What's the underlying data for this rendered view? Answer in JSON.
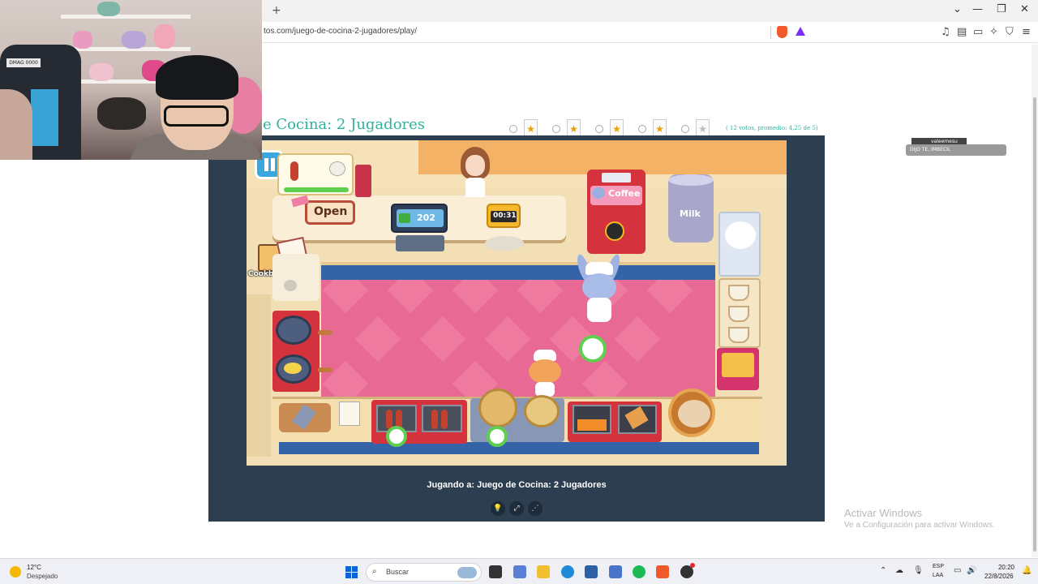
{
  "browser": {
    "url": "tos.com/juego-de-cocina-2-jugadores/play/",
    "new_tab_symbol": "+",
    "controls": {
      "menu": "⌄",
      "minimize": "—",
      "restore": "❐",
      "close": "✕"
    }
  },
  "webcam": {
    "chair_badge": "DMAG 0000"
  },
  "page": {
    "title": "e Cocina: 2 Jugadores",
    "rating": {
      "stars": [
        {
          "symbol": "★",
          "filled": true
        },
        {
          "symbol": "★",
          "filled": true
        },
        {
          "symbol": "★",
          "filled": true
        },
        {
          "symbol": "★",
          "filled": true
        },
        {
          "symbol": "★",
          "filled": false
        }
      ],
      "votes_text": "( 12 votos, promedio: 4,25 de 5)"
    },
    "chat": {
      "username": "valeemesu",
      "message": "DIJO TE, IMBECIL"
    }
  },
  "game": {
    "playing_label": "Jugando a: Juego de Cocina: 2 Jugadores",
    "hud": {
      "open_sign": "Open",
      "money": "202",
      "timer": "00:31",
      "coffee_label": "Coffee",
      "milk_label": "Milk",
      "cookbook_label": "Cookbook"
    },
    "controls": {
      "lightbulb_symbol": "💡",
      "fullscreen_symbol": "⤢",
      "share_symbol": "⋰"
    }
  },
  "watermark": {
    "line1": "Activar Windows",
    "line2": "Ve a Configuración para activar Windows."
  },
  "taskbar": {
    "temperature": "12°C",
    "condition": "Despejado",
    "search_placeholder": "Buscar",
    "lang_line1": "ESP",
    "lang_line2": "LAA",
    "time": "20:20",
    "date": "22/8/2026"
  },
  "colors": {
    "title_teal": "#2fb39a",
    "frame_navy": "#2c3e50",
    "floor_pink": "#e86a94",
    "accent_red": "#d6324a"
  }
}
